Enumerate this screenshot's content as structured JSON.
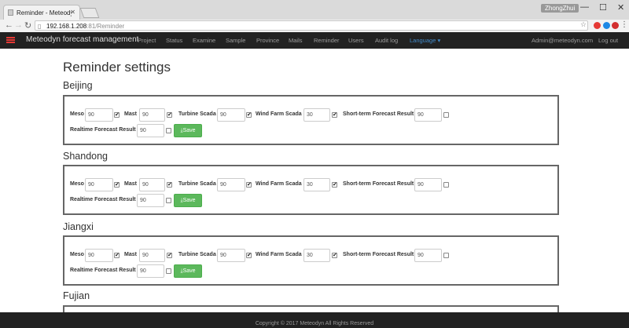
{
  "browser": {
    "tab_title": "Reminder - Meteodyn",
    "user_name": "ZhongZhui",
    "url_host": "192.168.1.208",
    "url_path": ":81/Reminder"
  },
  "navbar": {
    "brand": "Meteodyn forecast management",
    "items": [
      "Project",
      "Status",
      "Examine",
      "Sample",
      "Province",
      "Mails",
      "Reminder",
      "Users",
      "Audit log"
    ],
    "language": "Language ▾",
    "user": "Admin@meteodyn.com",
    "logout": "Log out"
  },
  "page": {
    "title": "Reminder settings"
  },
  "labels": {
    "meso": "Meso",
    "mast": "Mast",
    "turbine": "Turbine Scada",
    "windfarm": "Wind Farm Scada",
    "shortterm": "Short-term Forecast Result",
    "realtime": "Realtime Forecast Result",
    "save": "Save"
  },
  "provinces": [
    {
      "name": "Beijing",
      "meso": "90",
      "mast": "90",
      "turbine": "90",
      "windfarm": "30",
      "shortterm": "90",
      "realtime": "90",
      "checked": {
        "meso": true,
        "mast": true,
        "turbine": true,
        "windfarm": true,
        "shortterm": false,
        "realtime": false
      }
    },
    {
      "name": "Shandong",
      "meso": "90",
      "mast": "90",
      "turbine": "90",
      "windfarm": "30",
      "shortterm": "90",
      "realtime": "90",
      "checked": {
        "meso": true,
        "mast": true,
        "turbine": true,
        "windfarm": true,
        "shortterm": false,
        "realtime": false
      }
    },
    {
      "name": "Jiangxi",
      "meso": "90",
      "mast": "90",
      "turbine": "90",
      "windfarm": "30",
      "shortterm": "90",
      "realtime": "90",
      "checked": {
        "meso": true,
        "mast": true,
        "turbine": true,
        "windfarm": true,
        "shortterm": false,
        "realtime": false
      }
    },
    {
      "name": "Fujian"
    }
  ],
  "footer": {
    "text": "Copyright © 2017 Meteodyn All Rights Reserved"
  }
}
